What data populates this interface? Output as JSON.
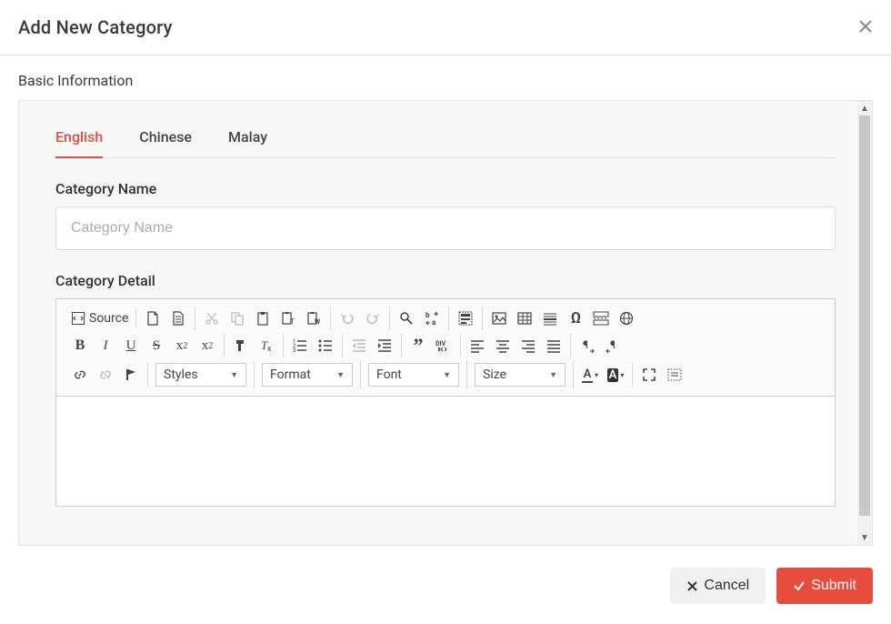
{
  "dialog": {
    "title": "Add New Category",
    "section_title": "Basic Information"
  },
  "tabs": [
    {
      "label": "English",
      "active": true
    },
    {
      "label": "Chinese"
    },
    {
      "label": "Malay"
    }
  ],
  "fields": {
    "name_label": "Category Name",
    "name_placeholder": "Category Name",
    "detail_label": "Category Detail"
  },
  "toolbar": {
    "source_label": "Source",
    "styles": "Styles",
    "format": "Format",
    "font": "Font",
    "size": "Size"
  },
  "footer": {
    "cancel": "Cancel",
    "submit": "Submit"
  }
}
